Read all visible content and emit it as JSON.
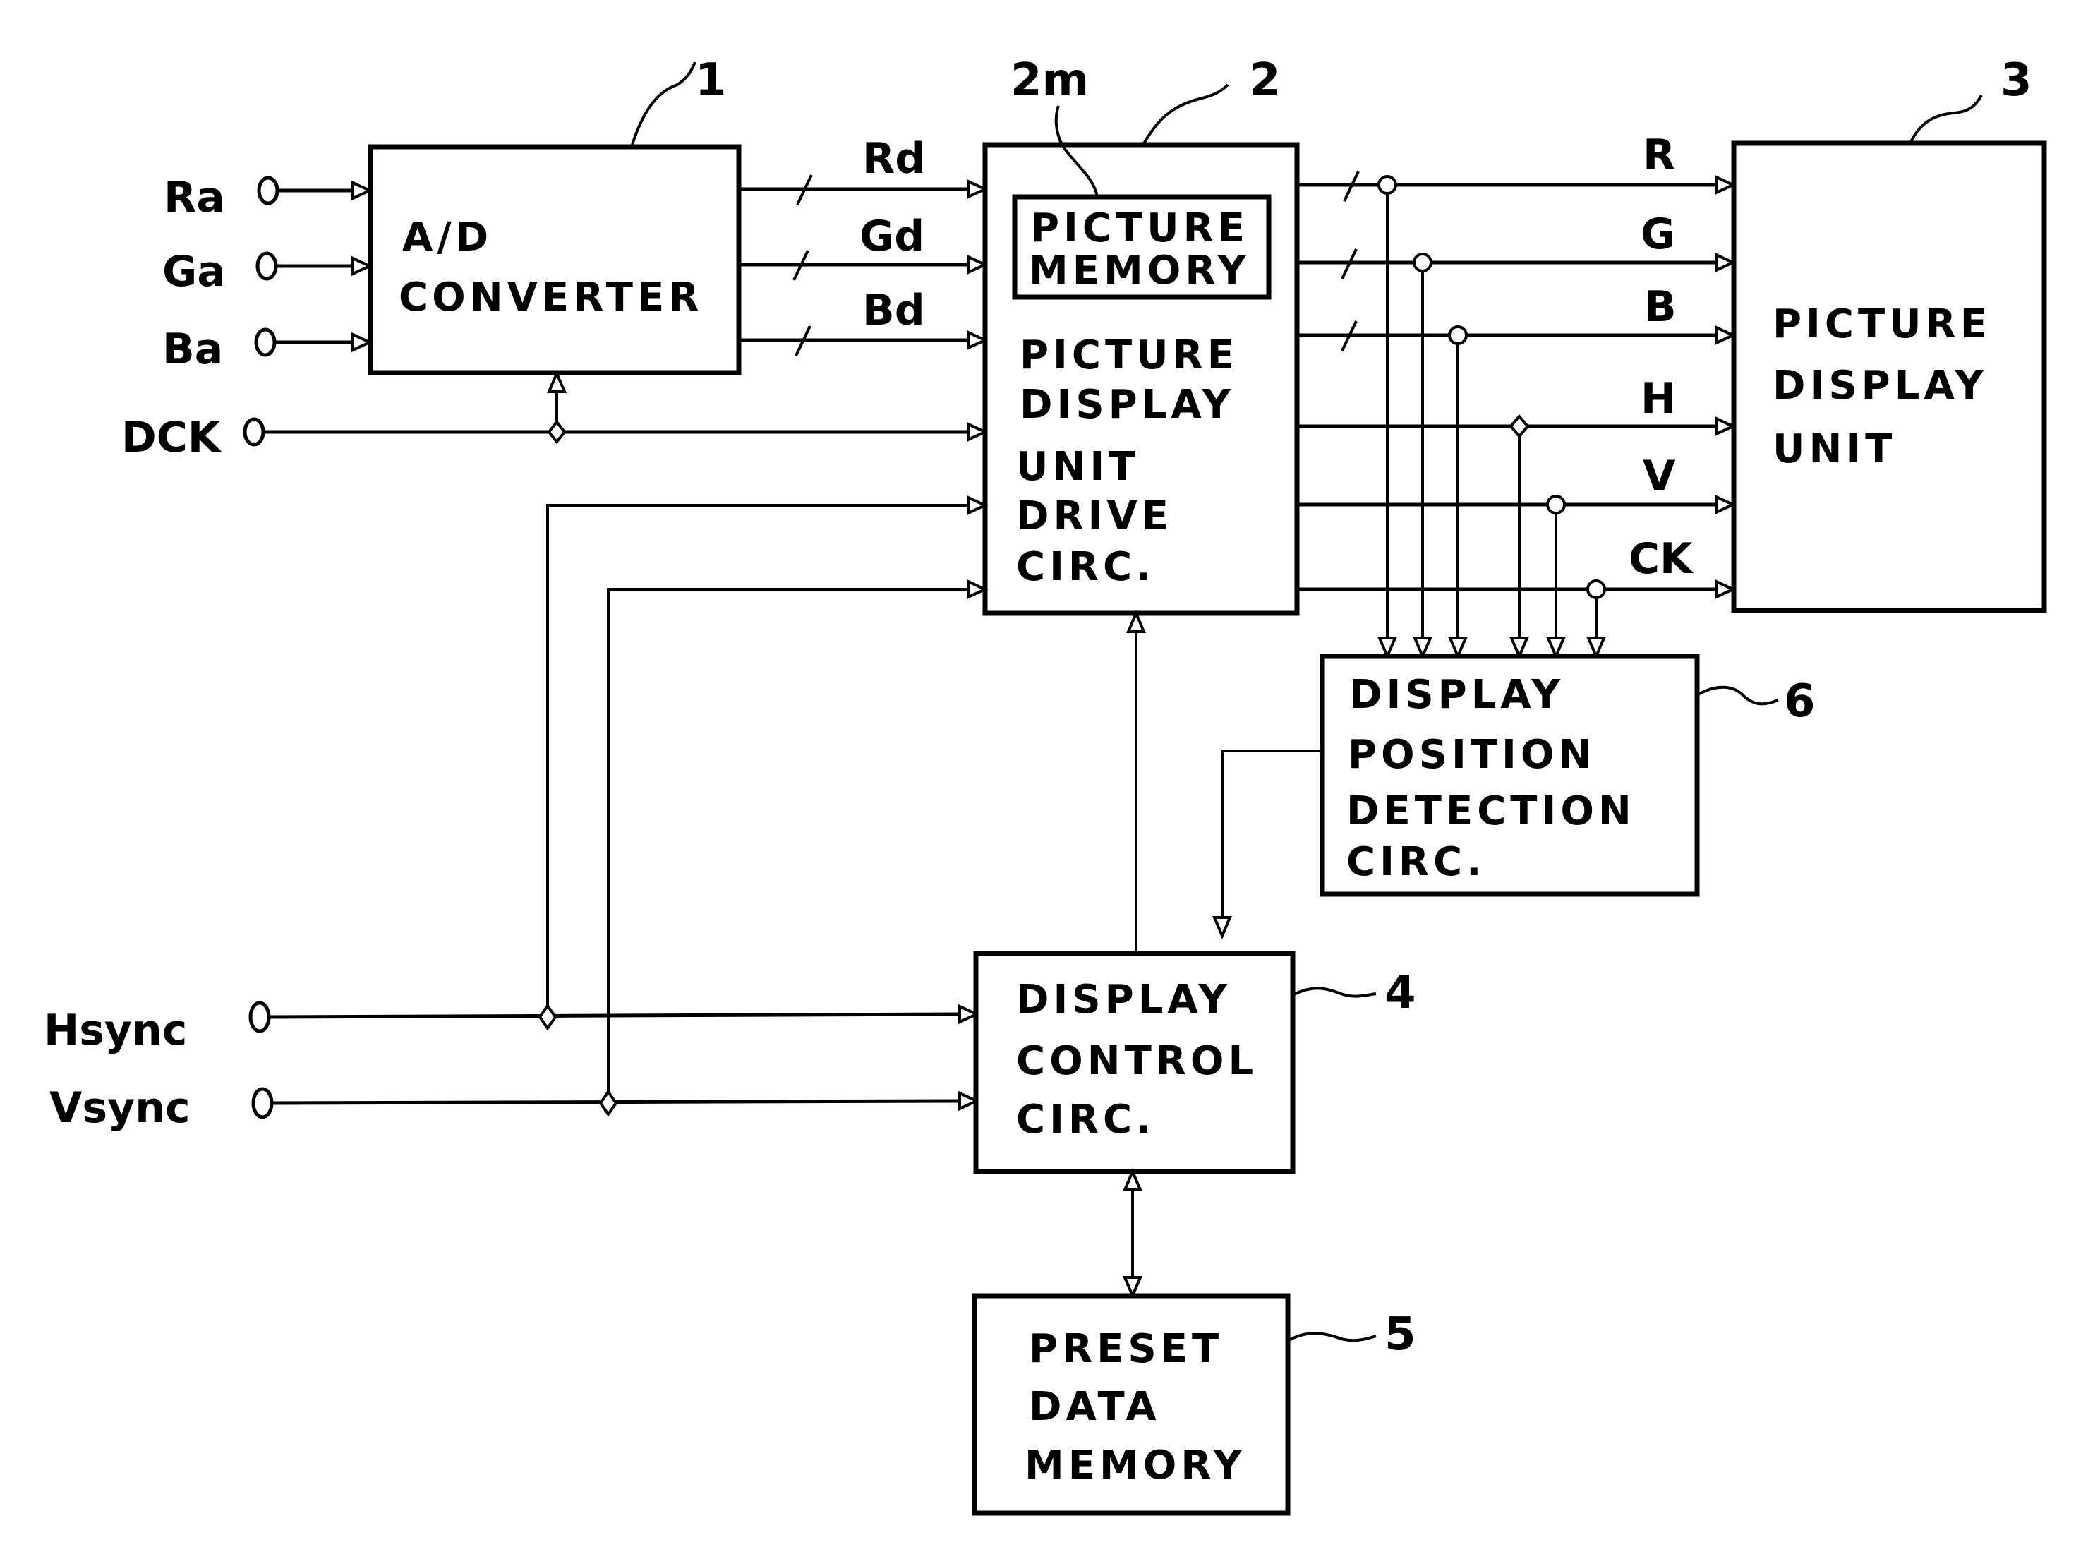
{
  "diagram": {
    "type": "block-diagram",
    "blocks": [
      {
        "id": "1",
        "ref": "1",
        "lines": [
          "A/D",
          "CONVERTER"
        ]
      },
      {
        "id": "2",
        "ref": "2",
        "lines": [
          "PICTURE",
          "DISPLAY",
          "UNIT",
          "DRIVE",
          "CIRC."
        ]
      },
      {
        "id": "2m",
        "ref": "2m",
        "lines": [
          "PICTURE",
          "MEMORY"
        ]
      },
      {
        "id": "3",
        "ref": "3",
        "lines": [
          "PICTURE",
          "DISPLAY",
          "UNIT"
        ]
      },
      {
        "id": "4",
        "ref": "4",
        "lines": [
          "DISPLAY",
          "CONTROL",
          "CIRC."
        ]
      },
      {
        "id": "5",
        "ref": "5",
        "lines": [
          "PRESET",
          "DATA",
          "MEMORY"
        ]
      },
      {
        "id": "6",
        "ref": "6",
        "lines": [
          "DISPLAY",
          "POSITION",
          "DETECTION",
          "CIRC."
        ]
      }
    ],
    "inputs": [
      "Ra",
      "Ga",
      "Ba",
      "DCK",
      "Hsync",
      "Vsync"
    ],
    "digital_signals": [
      "Rd",
      "Gd",
      "Bd"
    ],
    "output_signals": [
      "R",
      "G",
      "B",
      "H",
      "V",
      "CK"
    ],
    "connections": [
      {
        "from": "Ra",
        "to": "1"
      },
      {
        "from": "Ga",
        "to": "1"
      },
      {
        "from": "Ba",
        "to": "1"
      },
      {
        "from": "DCK",
        "to": "1"
      },
      {
        "from": "DCK",
        "to": "2"
      },
      {
        "from": "1",
        "to": "2",
        "signal": "Rd"
      },
      {
        "from": "1",
        "to": "2",
        "signal": "Gd"
      },
      {
        "from": "1",
        "to": "2",
        "signal": "Bd"
      },
      {
        "from": "Hsync",
        "to": "2"
      },
      {
        "from": "Vsync",
        "to": "2"
      },
      {
        "from": "Hsync",
        "to": "4"
      },
      {
        "from": "Vsync",
        "to": "4"
      },
      {
        "from": "2",
        "to": "3",
        "signal": "R"
      },
      {
        "from": "2",
        "to": "3",
        "signal": "G"
      },
      {
        "from": "2",
        "to": "3",
        "signal": "B"
      },
      {
        "from": "2",
        "to": "3",
        "signal": "H"
      },
      {
        "from": "2",
        "to": "3",
        "signal": "V"
      },
      {
        "from": "2",
        "to": "3",
        "signal": "CK"
      },
      {
        "from": "2",
        "to": "6",
        "signal": "R,G,B,H,V,CK"
      },
      {
        "from": "6",
        "to": "4"
      },
      {
        "from": "4",
        "to": "2"
      },
      {
        "from": "4",
        "to": "5",
        "bidirectional": true
      }
    ]
  }
}
